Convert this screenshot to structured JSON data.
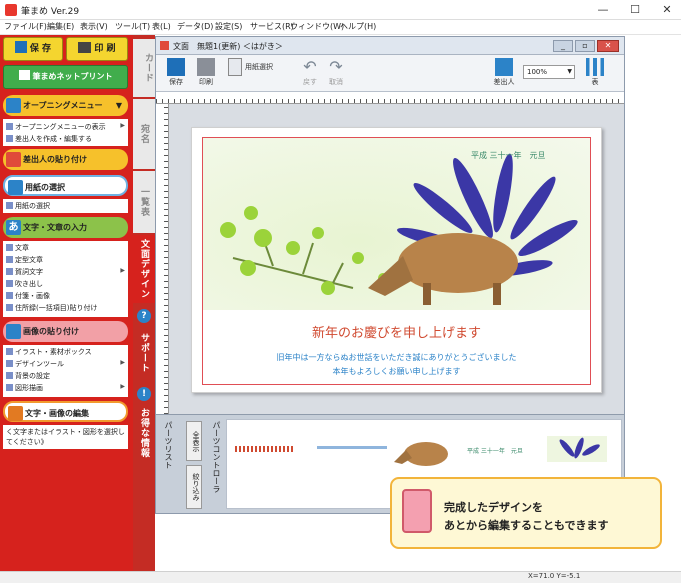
{
  "window": {
    "title": "筆まめ Ver.29",
    "min": "—",
    "max": "☐",
    "close": "✕"
  },
  "menu": [
    "ファイル(F)",
    "編集(E)",
    "表示(V)",
    "ツール(T)",
    "表(L)",
    "データ(D)",
    "設定(S)",
    "サービス(R)",
    "ウィンドウ(W)",
    "ヘルプ(H)"
  ],
  "left": {
    "save": "保 存",
    "print": "印 刷",
    "netprint": "筆まめネットプリント",
    "opening": {
      "label": "オープニングメニュー",
      "items": [
        "オープニングメニューの表示",
        "差出人を作成・編集する"
      ]
    },
    "sender": "差出人の貼り付け",
    "paper": {
      "label": "用紙の選択",
      "items": [
        "用紙の選択"
      ]
    },
    "text": {
      "label": "文字・文章の入力",
      "items": [
        "文章",
        "定型文章",
        "賀詞文字",
        "吹き出し",
        "付箋・画像",
        "住所録(一括項目)貼り付け"
      ]
    },
    "image": {
      "label": "画像の貼り付け",
      "items": [
        "イラスト・素材ボックス",
        "デザインツール",
        "背景の設定",
        "図形描画"
      ]
    },
    "edit": {
      "label": "文字・画像の編集",
      "hint": "く文字またはイラスト・図形を選択してください》"
    }
  },
  "tabs": [
    "カード",
    "宛名",
    "一覧表",
    "文面デザイン",
    "サポート",
    "お得な情報"
  ],
  "doc": {
    "title": "文面　無題1(更新) ＜はがき＞",
    "tools": [
      "保存",
      "印刷",
      "用紙選択",
      "戻す",
      "取消",
      "差出人",
      "100%",
      "表"
    ],
    "zoom": "100%",
    "card": {
      "date": "平成 三十一年　元旦",
      "greeting": "新年のお慶びを申し上げます",
      "line1": "旧年中は一方ならぬお世話をいただき誠にありがとうございました",
      "line2": "本年もよろしくお願い申し上げます"
    },
    "parts": {
      "side": "パーツリスト",
      "ctrl": "パーツコントローラ",
      "show": "全表示",
      "filter": "絞り込み",
      "thumb_date": "平成 三十一年　元旦"
    }
  },
  "callout": {
    "line1": "完成したデザインを",
    "line2": "あとから編集することもできます"
  },
  "status": {
    "coords": "X=71.0  Y=-5.1"
  }
}
